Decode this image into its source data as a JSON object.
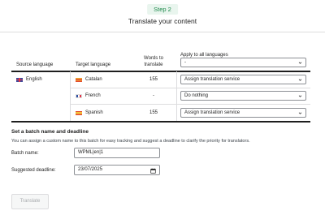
{
  "header": {
    "step_badge": "Step 2",
    "title": "Translate your content"
  },
  "table": {
    "columns": {
      "source": "Source language",
      "target": "Target language",
      "words": "Words to translate",
      "apply_all": "Apply to all languages"
    },
    "apply_all_select": "-",
    "source_language": {
      "label": "English",
      "flag": "flag-uk"
    },
    "rows": [
      {
        "language": "Catalan",
        "flag": "flag-catalonia",
        "words": "155",
        "action": "Assign translation service"
      },
      {
        "language": "French",
        "flag": "flag-france",
        "words": "-",
        "action": "Do nothing"
      },
      {
        "language": "Spanish",
        "flag": "flag-spain",
        "words": "155",
        "action": "Assign translation service"
      }
    ]
  },
  "batch": {
    "title": "Set a batch name and deadline",
    "description": "You can assign a custom name to this batch for easy tracking and suggest a deadline to clarify the priority for translators.",
    "name_label": "Batch name:",
    "name_value": "WPML|en|1",
    "deadline_label": "Suggested deadline:",
    "deadline_value": "23/07/2025"
  },
  "actions": {
    "translate_label": "Translate"
  },
  "icons": {
    "select_chevron": "chevron-down-icon",
    "calendar": "calendar-icon"
  },
  "colors": {
    "step_text": "#1f8a4c",
    "step_bg": "#e9f5ee",
    "border": "#8c8f94",
    "disabled_text": "#a7aaad"
  }
}
